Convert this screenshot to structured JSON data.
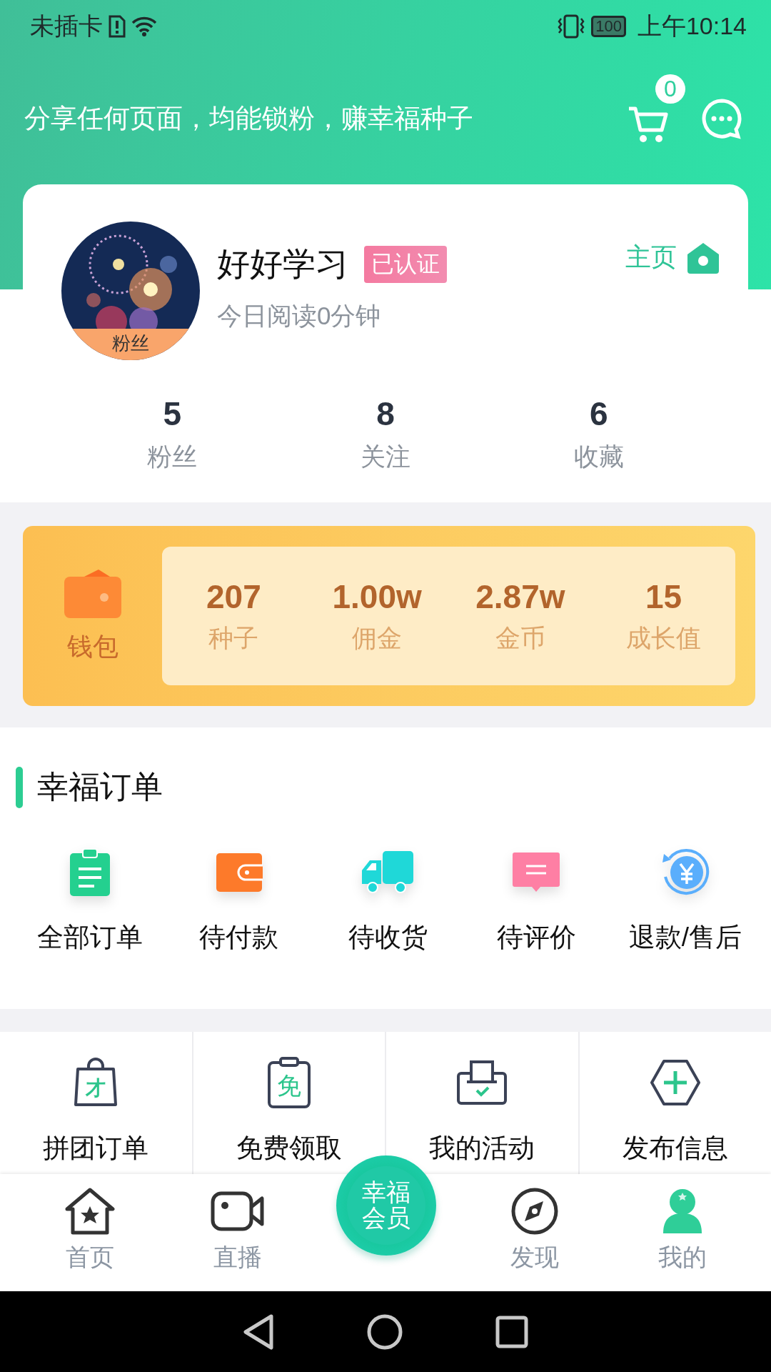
{
  "status_bar": {
    "carrier": "未插卡",
    "battery": "100",
    "time": "上午10:14"
  },
  "header": {
    "slogan": "分享任何页面，均能锁粉，赚幸福种子",
    "cart_count": "0"
  },
  "profile": {
    "avatar": {
      "kind": "picture",
      "badge": "粉丝"
    },
    "name": "好好学习",
    "verified_badge": "已认证",
    "reading": "今日阅读0分钟",
    "home_link": "主页",
    "stats": [
      {
        "value": "5",
        "label": "粉丝"
      },
      {
        "value": "8",
        "label": "关注"
      },
      {
        "value": "6",
        "label": "收藏"
      }
    ]
  },
  "wallet": {
    "label": "钱包",
    "stats": [
      {
        "value": "207",
        "label": "种子"
      },
      {
        "value": "1.00w",
        "label": "佣金"
      },
      {
        "value": "2.87w",
        "label": "金币"
      },
      {
        "value": "15",
        "label": "成长值"
      }
    ]
  },
  "orders": {
    "title": "幸福订单",
    "items": [
      {
        "kind": "clipboard",
        "label": "全部订单"
      },
      {
        "kind": "wallet",
        "label": "待付款"
      },
      {
        "kind": "truck",
        "label": "待收货"
      },
      {
        "kind": "comment",
        "label": "待评价"
      },
      {
        "kind": "refund",
        "label": "退款/售后"
      }
    ]
  },
  "tools": [
    {
      "kind": "bag",
      "glyph": "才",
      "label": "拼团订单"
    },
    {
      "kind": "clipboard",
      "glyph": "免",
      "label": "免费领取"
    },
    {
      "kind": "printer",
      "label": "我的活动"
    },
    {
      "kind": "add",
      "label": "发布信息"
    }
  ],
  "tab_bar": [
    {
      "kind": "home",
      "label": "首页",
      "selected": false
    },
    {
      "kind": "video",
      "label": "直播",
      "selected": false
    },
    {
      "kind": "member",
      "label": "幸福会员",
      "selected": false
    },
    {
      "kind": "compass",
      "label": "发现",
      "selected": false
    },
    {
      "kind": "person",
      "label": "我的",
      "selected": true
    }
  ]
}
